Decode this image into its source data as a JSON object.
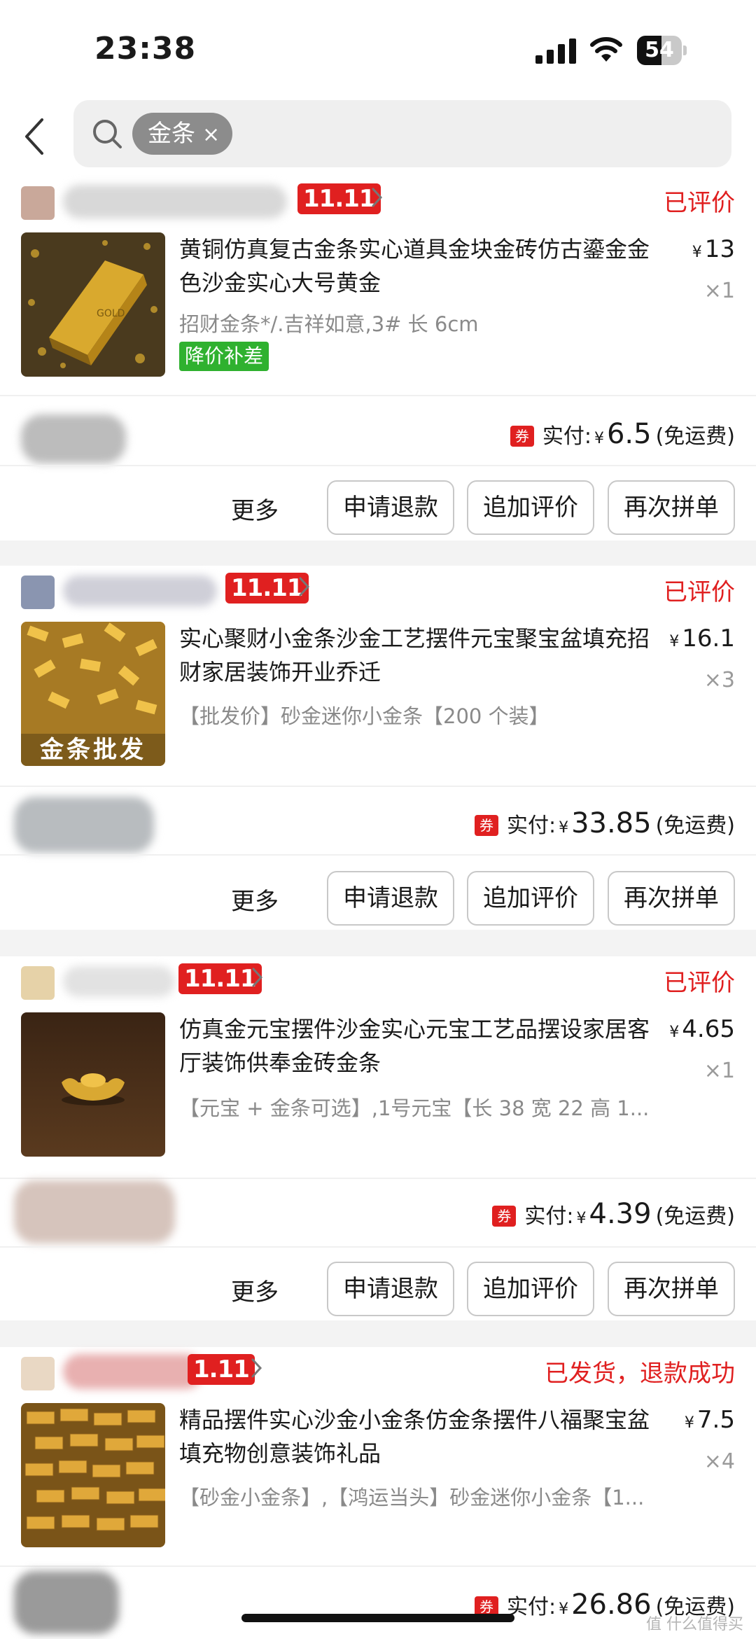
{
  "status_bar": {
    "time": "23:38",
    "battery": "54",
    "battery_level": 0.54
  },
  "search": {
    "chip_label": "金条",
    "chip_remove": "×"
  },
  "orders": [
    {
      "badge": "11.11",
      "status": "已评价",
      "title": "黄铜仿真复古金条实心道具金块金砖仿古鎏金金色沙金实心大号黄金",
      "spec": "招财金条*/.吉祥如意,3# 长 6cm",
      "price": "13",
      "qty": "×1",
      "tag": "降价补差",
      "pay_label": "实付:",
      "pay_amount": "6.5",
      "shipping": "(免运费)"
    },
    {
      "badge": "11.11",
      "status": "已评价",
      "title": "实心聚财小金条沙金工艺摆件元宝聚宝盆填充招财家居装饰开业乔迁",
      "spec": "【批发价】砂金迷你小金条【200 个装】",
      "price": "16.1",
      "qty": "×3",
      "thumb_text": "金条批发",
      "pay_label": "实付:",
      "pay_amount": "33.85",
      "shipping": "(免运费)"
    },
    {
      "badge": "11.11",
      "status": "已评价",
      "title": "仿真金元宝摆件沙金实心元宝工艺品摆设家居客厅装饰供奉金砖金条",
      "spec": "【元宝 + 金条可选】,1号元宝【长 38 宽 22 高 1...",
      "price": "4.65",
      "qty": "×1",
      "pay_label": "实付:",
      "pay_amount": "4.39",
      "shipping": "(免运费)"
    },
    {
      "badge": "1.11",
      "status": "已发货，退款成功",
      "title": "精品摆件实心沙金小金条仿金条摆件八福聚宝盆填充物创意装饰礼品",
      "spec": "【砂金小金条】,【鸿运当头】砂金迷你小金条【1...",
      "price": "7.5",
      "qty": "×4",
      "pay_label": "实付:",
      "pay_amount": "26.86",
      "shipping": "(免运费)"
    }
  ],
  "common": {
    "yen": "¥",
    "coupon": "券",
    "more": "更多",
    "refund": "申请退款",
    "add_review": "追加评价",
    "reorder": "再次拼单"
  },
  "watermark": "值 什么值得买",
  "colors": {
    "accent_red": "#e02020",
    "tag_green": "#2fb12f",
    "page_bg": "#f3f3f3"
  }
}
